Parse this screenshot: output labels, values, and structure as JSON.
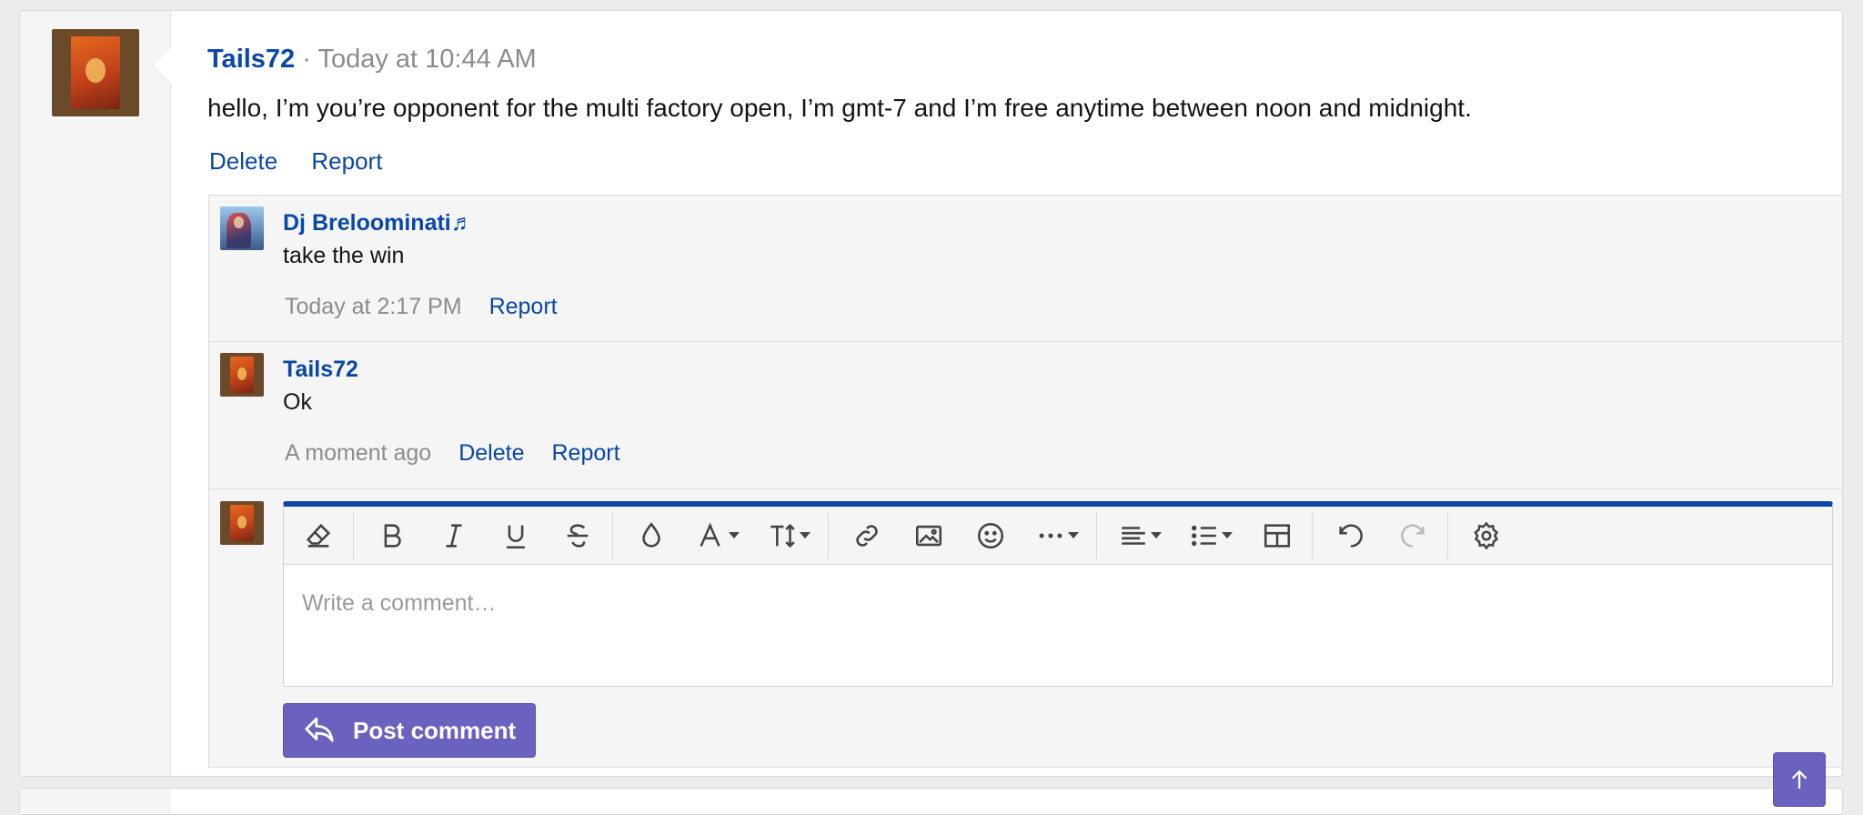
{
  "post": {
    "author": "Tails72",
    "separator": "·",
    "time": "Today at 10:44 AM",
    "message": "hello, I’m you’re opponent for the multi factory open, I’m gmt-7 and I’m free anytime between noon and midnight.",
    "actions": {
      "delete": "Delete",
      "report": "Report"
    }
  },
  "comments": [
    {
      "author": "Dj Breloominati♬",
      "text": "take the win",
      "time": "Today at 2:17 PM",
      "report": "Report"
    },
    {
      "author": "Tails72",
      "text": "Ok",
      "time": "A moment ago",
      "delete": "Delete",
      "report": "Report"
    }
  ],
  "editor": {
    "placeholder": "Write a comment…",
    "submit_label": "Post comment",
    "toolbar_icons": [
      "eraser-icon",
      "bold-icon",
      "italic-icon",
      "underline-icon",
      "strikethrough-icon",
      "text-color-icon",
      "font-family-icon",
      "font-size-icon",
      "link-icon",
      "image-icon",
      "emoji-icon",
      "more-options-icon",
      "align-icon",
      "list-icon",
      "table-icon",
      "undo-icon",
      "redo-icon",
      "settings-icon"
    ]
  },
  "colors": {
    "link": "#0a47a8",
    "button": "#6b62c0",
    "editor_accent": "#0a47a8"
  }
}
